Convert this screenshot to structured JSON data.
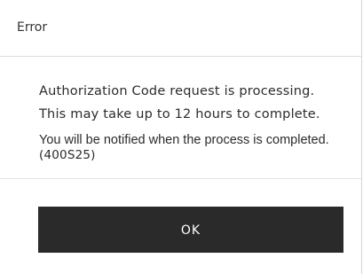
{
  "dialog": {
    "title": "Error",
    "message_line1": "Authorization Code request is processing.",
    "message_line2": "This may take up to 12 hours to complete.",
    "message_line3": "You will be notified when the process is completed.",
    "error_code": "(400S25)",
    "ok_label": "OK"
  },
  "colors": {
    "button_background": "#2a2a2a",
    "button_text": "#ffffff",
    "divider": "#dcdcdc"
  }
}
